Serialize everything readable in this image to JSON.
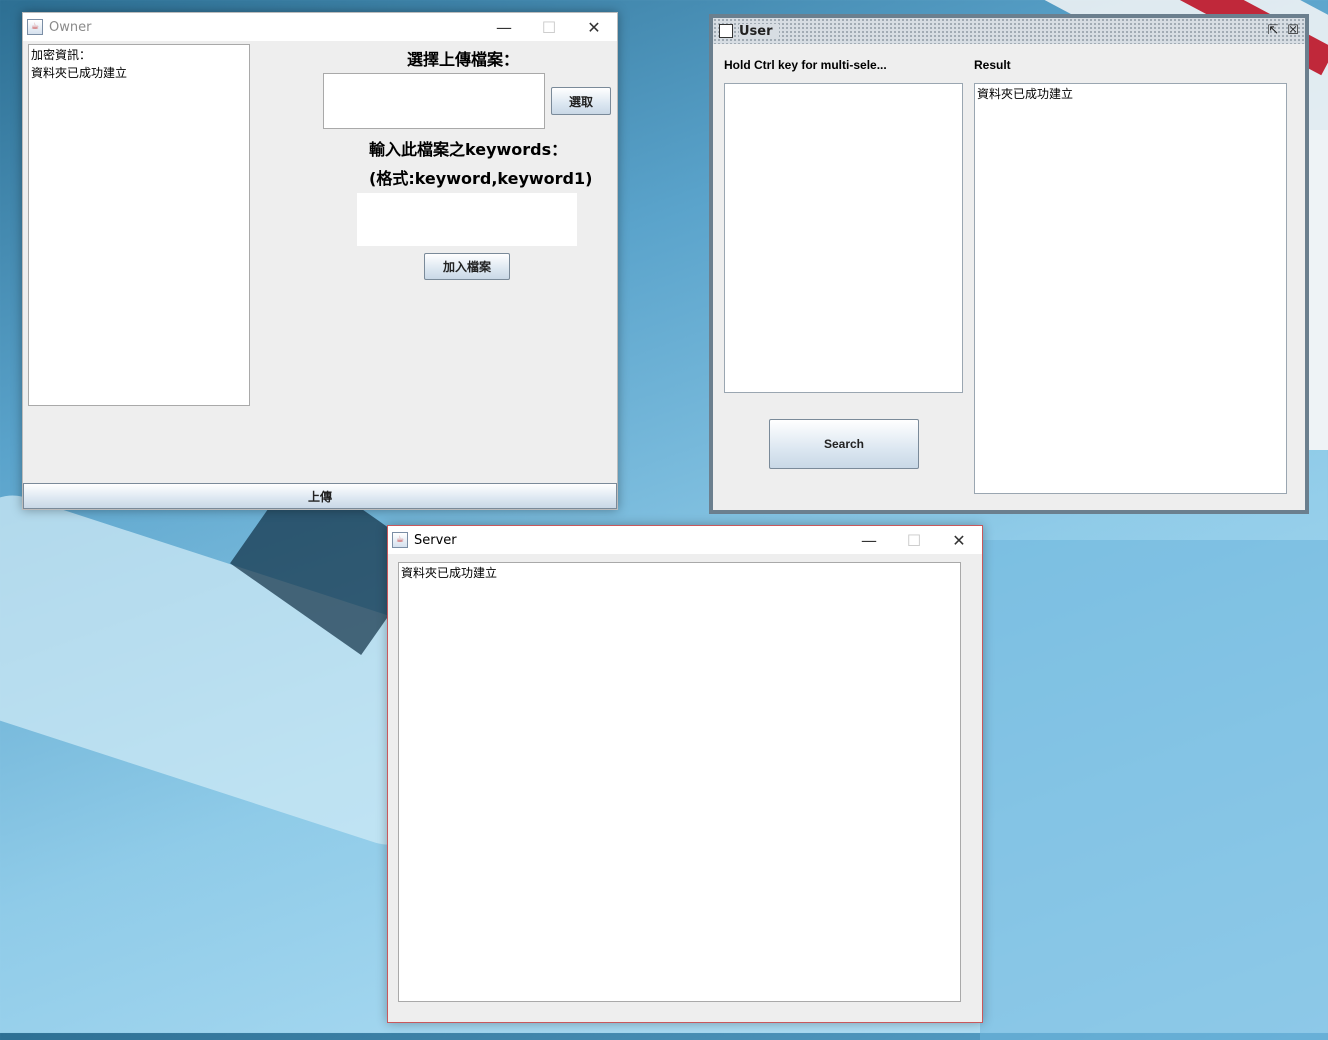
{
  "owner": {
    "title": "Owner",
    "log_text": "加密資訊：\n資料夾已成功建立",
    "select_file_label": "選擇上傳檔案：",
    "select_button": "選取",
    "keywords_label": "輸入此檔案之keywords：",
    "keywords_format": "(格式:keyword,keyword1)",
    "add_file_button": "加入檔案",
    "upload_button": "上傳",
    "controls": {
      "minimize": "—",
      "maximize": "☐",
      "close": "✕"
    }
  },
  "user": {
    "title": "User",
    "multi_select_label": "Hold Ctrl key for multi-sele...",
    "result_label": "Result",
    "result_text": "資料夾已成功建立",
    "search_button": "Search",
    "controls": {
      "restore": "⇱",
      "close": "☒"
    }
  },
  "server": {
    "title": "Server",
    "log_text": "資料夾已成功建立",
    "controls": {
      "minimize": "—",
      "maximize": "☐",
      "close": "✕"
    }
  }
}
